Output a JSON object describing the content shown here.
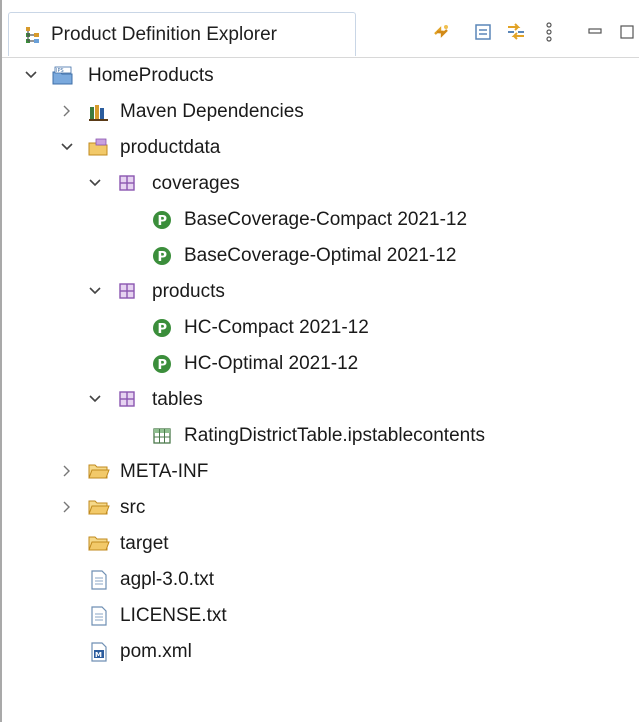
{
  "view": {
    "title": "Product Definition Explorer",
    "toolbar": [
      "sync-icon",
      "collapse-all-icon",
      "link-with-editor-icon",
      "view-menu-icon",
      "minimize-icon",
      "maximize-icon"
    ]
  },
  "tree": {
    "root": "HomeProducts",
    "maven_dependencies": "Maven Dependencies",
    "productdata": "productdata",
    "coverages": "coverages",
    "coverage_items": [
      "BaseCoverage-Compact 2021-12",
      "BaseCoverage-Optimal 2021-12"
    ],
    "products": "products",
    "product_items": [
      "HC-Compact 2021-12",
      "HC-Optimal 2021-12"
    ],
    "tables": "tables",
    "table_items": [
      "RatingDistrictTable.ipstablecontents"
    ],
    "meta_inf": "META-INF",
    "src": "src",
    "target": "target",
    "files": [
      "agpl-3.0.txt",
      "LICENSE.txt",
      "pom.xml"
    ]
  },
  "colors": {
    "folder": "#e8b34a",
    "package": "#8a56b0",
    "product_badge": "#3b8e3b",
    "tab_border": "#c9d6e6"
  }
}
